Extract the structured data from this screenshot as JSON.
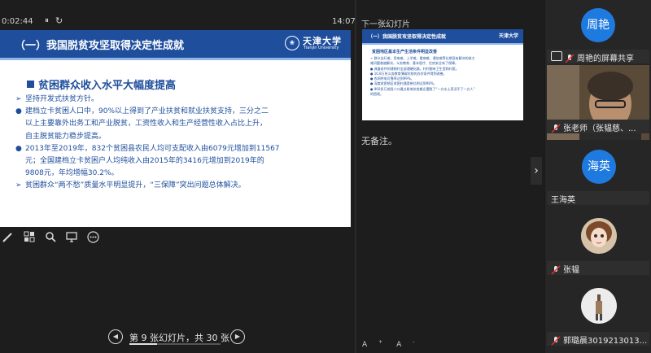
{
  "presenter": {
    "timer": "0:02:44",
    "pause_glyph": "⏸",
    "reset_glyph": "↻",
    "clock": "14:07",
    "next_label": "下一张幻灯片",
    "notes": "无备注。",
    "font_increase": "A",
    "font_decrease": "A",
    "tools": [
      "pen-icon",
      "grid-view-icon",
      "zoom-icon",
      "screen-icon",
      "more-icon"
    ]
  },
  "slide": {
    "title": "（一）我国脱贫攻坚取得决定性成就",
    "logo_cn": "天津大学",
    "logo_en": "Tianjin University",
    "heading": "贫困群众收入水平大幅度提高",
    "lines": [
      {
        "marker": "➢",
        "text": "坚持开发式扶贫方针。"
      },
      {
        "marker": "●",
        "text": "建档立卡贫困人口中，90%以上得到了产业扶贫和就业扶贫支持，三分之二"
      },
      {
        "marker": "",
        "text": "以上主要靠外出务工和产业脱贫，工资性收入和生产经营性收入占比上升，"
      },
      {
        "marker": "",
        "text": "自主脱贫能力稳步提高。"
      },
      {
        "marker": "●",
        "text": "2013年至2019年，832个贫困县农民人均可支配收入由6079元增加到11567"
      },
      {
        "marker": "",
        "text": "元；全国建档立卡贫困户人均纯收入由2015年的3416元增加到2019年的"
      },
      {
        "marker": "",
        "text": "9808元，年均增幅30.2%。"
      },
      {
        "marker": "➢",
        "text": "贫困群众“两不愁”质量水平明显提升，“三保障”突出问题总体解决。"
      }
    ]
  },
  "next_slide": {
    "title": "（一）我国脱贫攻坚取得决定性成就",
    "logo": "天津大学",
    "heading": "贫困地区基本生产生活条件明显改善",
    "lines": [
      "➢ 群众出行难、用电难、上学难、看病难、通信难等长期没有解决的老大",
      "  难问题普遍解决，义务教育、基本医疗、住房安全有了保障。",
      "● 具备条件的建制村全部通硬化路，村村都有卫生室和村医。",
      "● 10.8万所义务教育薄弱学校的办学条件得到改善。",
      "● 农网供电可靠率达到99%。",
      "● 深度贫困地区贫困村通宽带比例达到98%。",
      "● 960多万贫困人口通过易地扶贫搬迁摆脱了“一方水土养活不了一方人”",
      "  的困境。"
    ]
  },
  "navigation": {
    "prev_glyph": "◀",
    "next_glyph": "▶",
    "slide_text": "第 9 张幻灯片，共 30 张",
    "progress": 0.3
  },
  "expand_glyph": "›",
  "participants": [
    {
      "avatar_text": "周艳",
      "label": "周艳的屏幕共享",
      "avatar_color": "#1f7ae0"
    },
    {
      "avatar_text": "",
      "label": "张老师（张韫慈、...",
      "avatar_color": ""
    },
    {
      "avatar_text": "海英",
      "label": "王海英",
      "avatar_color": "#1f7ae0"
    },
    {
      "avatar_text": "",
      "label": "张韫",
      "avatar_color": "#8a6a50"
    },
    {
      "avatar_text": "",
      "label": "郭璐晨3019213013...",
      "avatar_color": "#d8d8d8"
    }
  ]
}
